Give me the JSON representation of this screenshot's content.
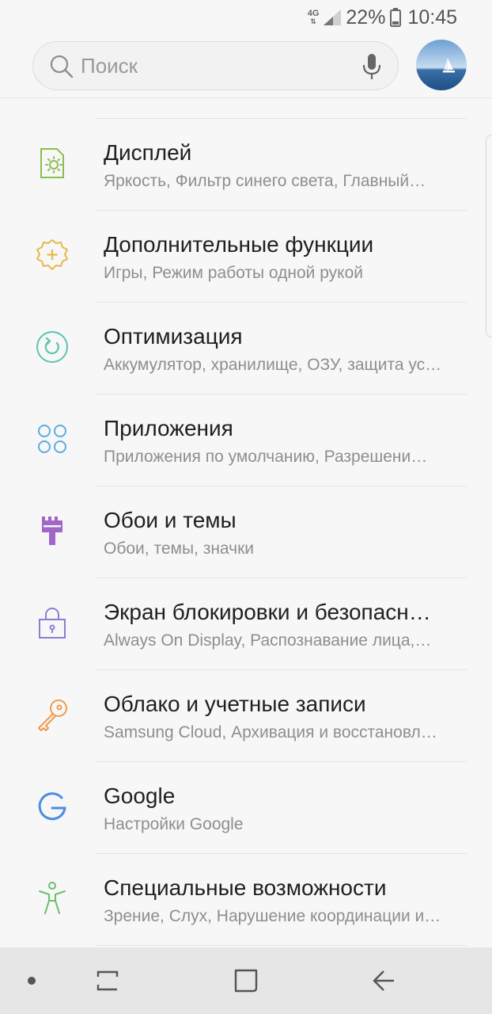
{
  "status_bar": {
    "network": "4G",
    "battery": "22%",
    "time": "10:45",
    "icons": [
      "data-arrows-icon",
      "signal-icon",
      "battery-icon"
    ]
  },
  "search": {
    "placeholder": "Поиск",
    "icons": [
      "search-icon",
      "mic-icon"
    ],
    "avatar": "sailboat-avatar"
  },
  "settings": [
    {
      "icon": "display-icon",
      "icon_color": "#8bbd4f",
      "title": "Дисплей",
      "subtitle": "Яркость, Фильтр синего света, Главный…"
    },
    {
      "icon": "gear-plus-icon",
      "icon_color": "#e8b84a",
      "title": "Дополнительные функции",
      "subtitle": "Игры, Режим работы одной рукой"
    },
    {
      "icon": "optimization-icon",
      "icon_color": "#5cc4b0",
      "title": "Оптимизация",
      "subtitle": "Аккумулятор, хранилище, ОЗУ, защита ус…"
    },
    {
      "icon": "apps-icon",
      "icon_color": "#5aaee0",
      "title": "Приложения",
      "subtitle": "Приложения по умолчанию, Разрешени…"
    },
    {
      "icon": "paint-brush-icon",
      "icon_color": "#a066c8",
      "title": "Обои и темы",
      "subtitle": "Обои, темы, значки"
    },
    {
      "icon": "lock-icon",
      "icon_color": "#8a7fd6",
      "title": "Экран блокировки и безопасн…",
      "subtitle": "Always On Display, Распознавание лица,…"
    },
    {
      "icon": "key-icon",
      "icon_color": "#ef9a4e",
      "title": "Облако и учетные записи",
      "subtitle": "Samsung Cloud, Архивация и восстановл…"
    },
    {
      "icon": "google-icon",
      "icon_color": "#4a8ee0",
      "title": "Google",
      "subtitle": "Настройки Google"
    },
    {
      "icon": "accessibility-icon",
      "icon_color": "#6cbf6c",
      "title": "Специальные возможности",
      "subtitle": "Зрение, Слух, Нарушение координации и…"
    }
  ],
  "nav_bar": {
    "buttons": [
      "dot-icon",
      "recent-apps-icon",
      "home-icon",
      "back-icon"
    ]
  }
}
